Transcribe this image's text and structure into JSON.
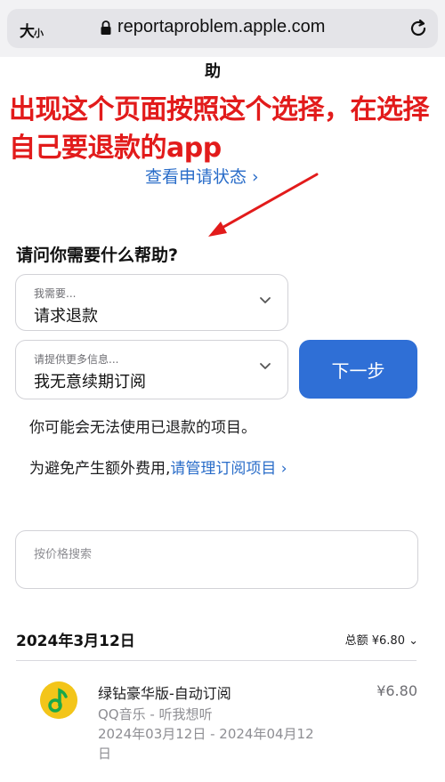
{
  "browser": {
    "text_size_label_big": "大",
    "text_size_label_small": "小",
    "url": "reportaproblem.apple.com"
  },
  "page": {
    "partial_title": "助",
    "check_status_link": "查看申请状态 ›",
    "question": "请问你需要什么帮助?",
    "select_need": {
      "caption": "我需要...",
      "value": "请求退款"
    },
    "select_more": {
      "caption": "请提供更多信息...",
      "value": "我无意续期订阅"
    },
    "next_button": "下一步",
    "note_refund": "你可能会无法使用已退款的项目。",
    "note_extra_prefix": "为避免产生额外费用,",
    "note_extra_link": "请管理订阅项目 ›",
    "search_placeholder": "按价格搜索",
    "purchase_date": "2024年3月12日",
    "purchase_total": "总额 ¥6.80 ⌄"
  },
  "annotation": {
    "text": "出现这个页面按照这个选择，在选择自己要退款的app",
    "color": "#e21b1b"
  },
  "items": [
    {
      "title": "绿钻豪华版-自动订阅",
      "price": "¥6.80",
      "app": "QQ音乐 - 听我想听",
      "dates": "2024年03月12日 - 2024年04月12日",
      "icon": "qq-music-icon"
    }
  ],
  "colors": {
    "accent": "#2f6fd6",
    "link": "#2a6dc9",
    "annotation": "#e21b1b"
  }
}
